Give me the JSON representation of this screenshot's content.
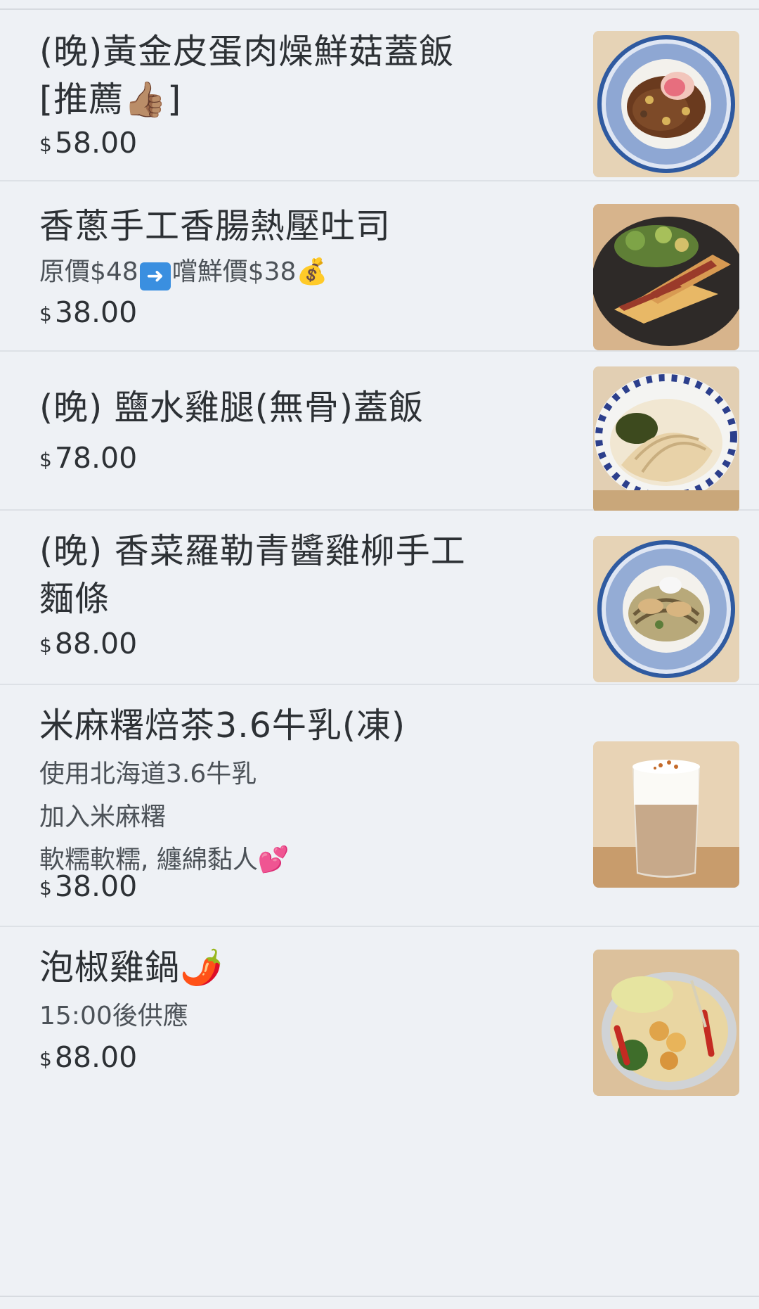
{
  "menu": {
    "currency": "$",
    "items": [
      {
        "title_lines": [
          "(晚)黃金皮蛋肉燥鮮菇蓋飯",
          "[推薦👍🏽]"
        ],
        "desc_lines": [],
        "price": "58.00",
        "image_icon": "rice-bowl-egg"
      },
      {
        "title_lines": [
          "香蔥手工香腸熱壓吐司"
        ],
        "desc_lines": [
          "原價$48➡️嚐鮮價$38💰"
        ],
        "price": "38.00",
        "image_icon": "pressed-toast-salad"
      },
      {
        "title_lines": [
          "(晚) 鹽水雞腿(無骨)蓋飯"
        ],
        "desc_lines": [],
        "price": "78.00",
        "image_icon": "chicken-rice-bowl"
      },
      {
        "title_lines": [
          "(晚) 香菜羅勒青醬雞柳手工",
          "麵條"
        ],
        "desc_lines": [],
        "price": "88.00",
        "image_icon": "pesto-noodle-bowl"
      },
      {
        "title_lines": [
          "米麻糬焙茶3.6牛乳(凍)"
        ],
        "desc_lines": [
          "使用北海道3.6牛乳",
          "加入米麻糬",
          "軟糯軟糯, 纏綿黏人💕"
        ],
        "price": "38.00",
        "image_icon": "milk-tea-glass"
      },
      {
        "title_lines": [
          "泡椒雞鍋🌶️"
        ],
        "desc_lines": [
          "15:00後供應"
        ],
        "price": "88.00",
        "image_icon": "chicken-hot-pot"
      }
    ]
  }
}
